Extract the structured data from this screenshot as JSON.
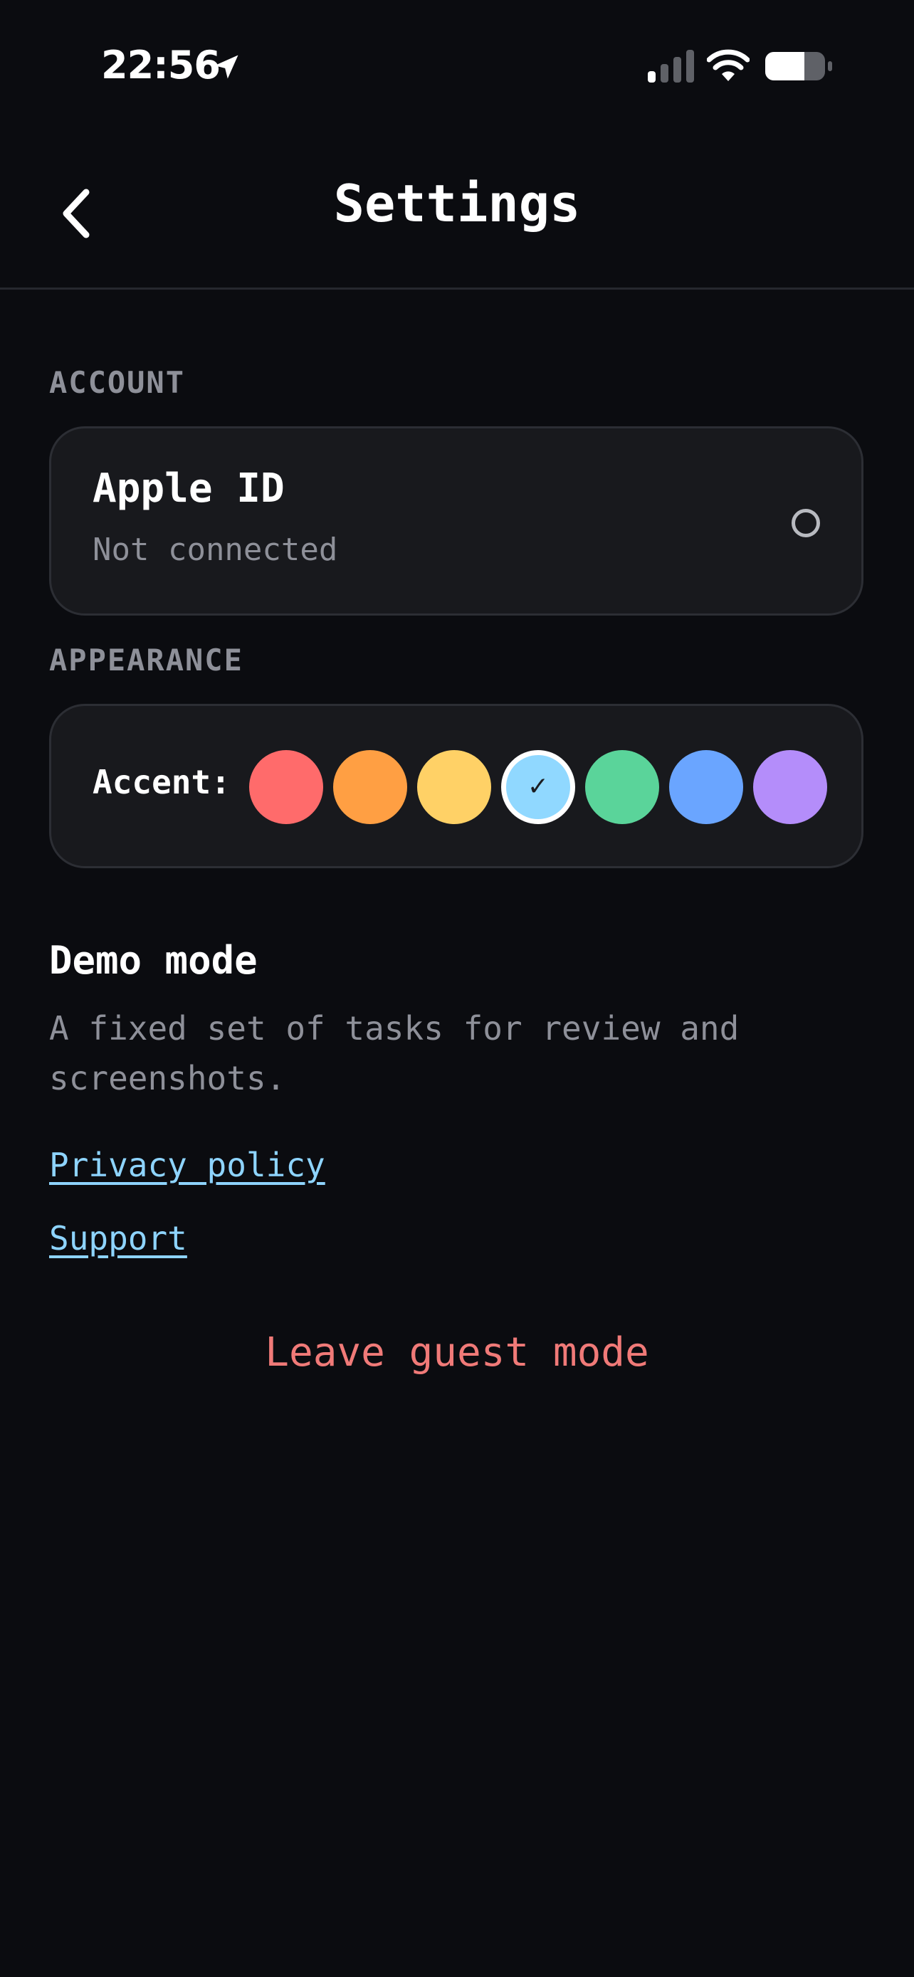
{
  "status_bar": {
    "time": "22:56",
    "icons": [
      "location-arrow-icon",
      "cellular-signal-icon",
      "wifi-icon",
      "battery-icon"
    ]
  },
  "nav": {
    "back_icon": "chevron-left-icon",
    "title": "Settings"
  },
  "account": {
    "header": "ACCOUNT",
    "apple_id": {
      "title": "Apple ID",
      "subtitle": "Not connected",
      "selected": false
    }
  },
  "appearance": {
    "header": "APPEARANCE",
    "accent_label": "Accent:",
    "swatches": [
      {
        "name": "red",
        "color": "#ff6b6b",
        "selected": false
      },
      {
        "name": "orange",
        "color": "#ff9f43",
        "selected": false
      },
      {
        "name": "yellow",
        "color": "#ffd166",
        "selected": false
      },
      {
        "name": "light-blue",
        "color": "#90d8ff",
        "selected": true
      },
      {
        "name": "green",
        "color": "#5ad49a",
        "selected": false
      },
      {
        "name": "blue",
        "color": "#6aa5ff",
        "selected": false
      },
      {
        "name": "purple",
        "color": "#b48dfa",
        "selected": false
      }
    ],
    "check_glyph": "✓"
  },
  "demo": {
    "title": "Demo mode",
    "description": "A fixed set of tasks for review and screenshots."
  },
  "links": {
    "privacy": "Privacy policy",
    "support": "Support"
  },
  "leave_guest": "Leave guest mode",
  "colors": {
    "background": "#0b0c10",
    "card": "#18191d",
    "link": "#8ed4ff",
    "danger": "#f07a78",
    "muted": "#8e9099"
  }
}
